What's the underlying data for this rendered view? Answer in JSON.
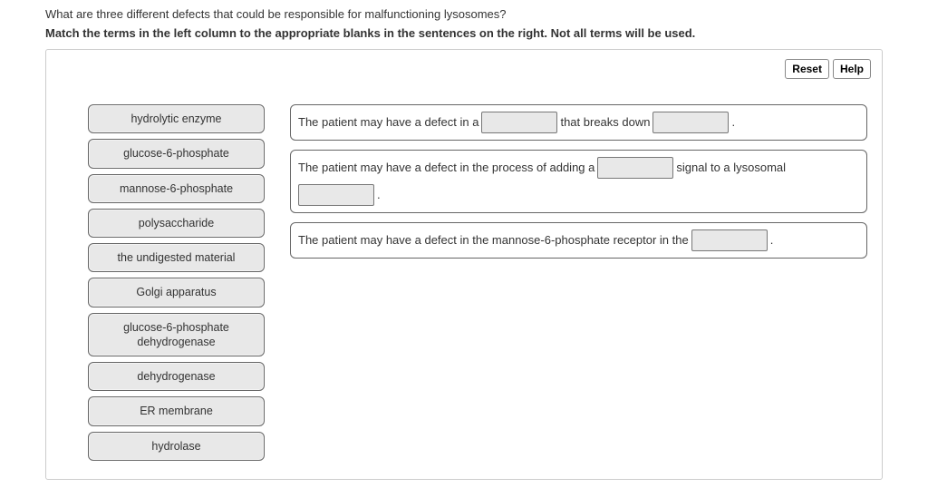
{
  "question": "What are three different defects that could be responsible for malfunctioning lysosomes?",
  "instruction": "Match the terms in the left column to the appropriate blanks in the sentences on the right. Not all terms will be used.",
  "buttons": {
    "reset": "Reset",
    "help": "Help"
  },
  "terms": [
    "hydrolytic enzyme",
    "glucose-6-phosphate",
    "mannose-6-phosphate",
    "polysaccharide",
    "the undigested material",
    "Golgi apparatus",
    "glucose-6-phosphate dehydrogenase",
    "dehydrogenase",
    "ER membrane",
    "hydrolase"
  ],
  "sentences": {
    "s1": {
      "p1": "The patient may have a defect in a",
      "p2": "that breaks down",
      "p3": "."
    },
    "s2": {
      "p1": "The patient may have a defect in the process of adding a",
      "p2": "signal to a lysosomal",
      "p3": "."
    },
    "s3": {
      "p1": "The patient may have a defect in the mannose-6-phosphate receptor in the",
      "p2": "."
    }
  }
}
